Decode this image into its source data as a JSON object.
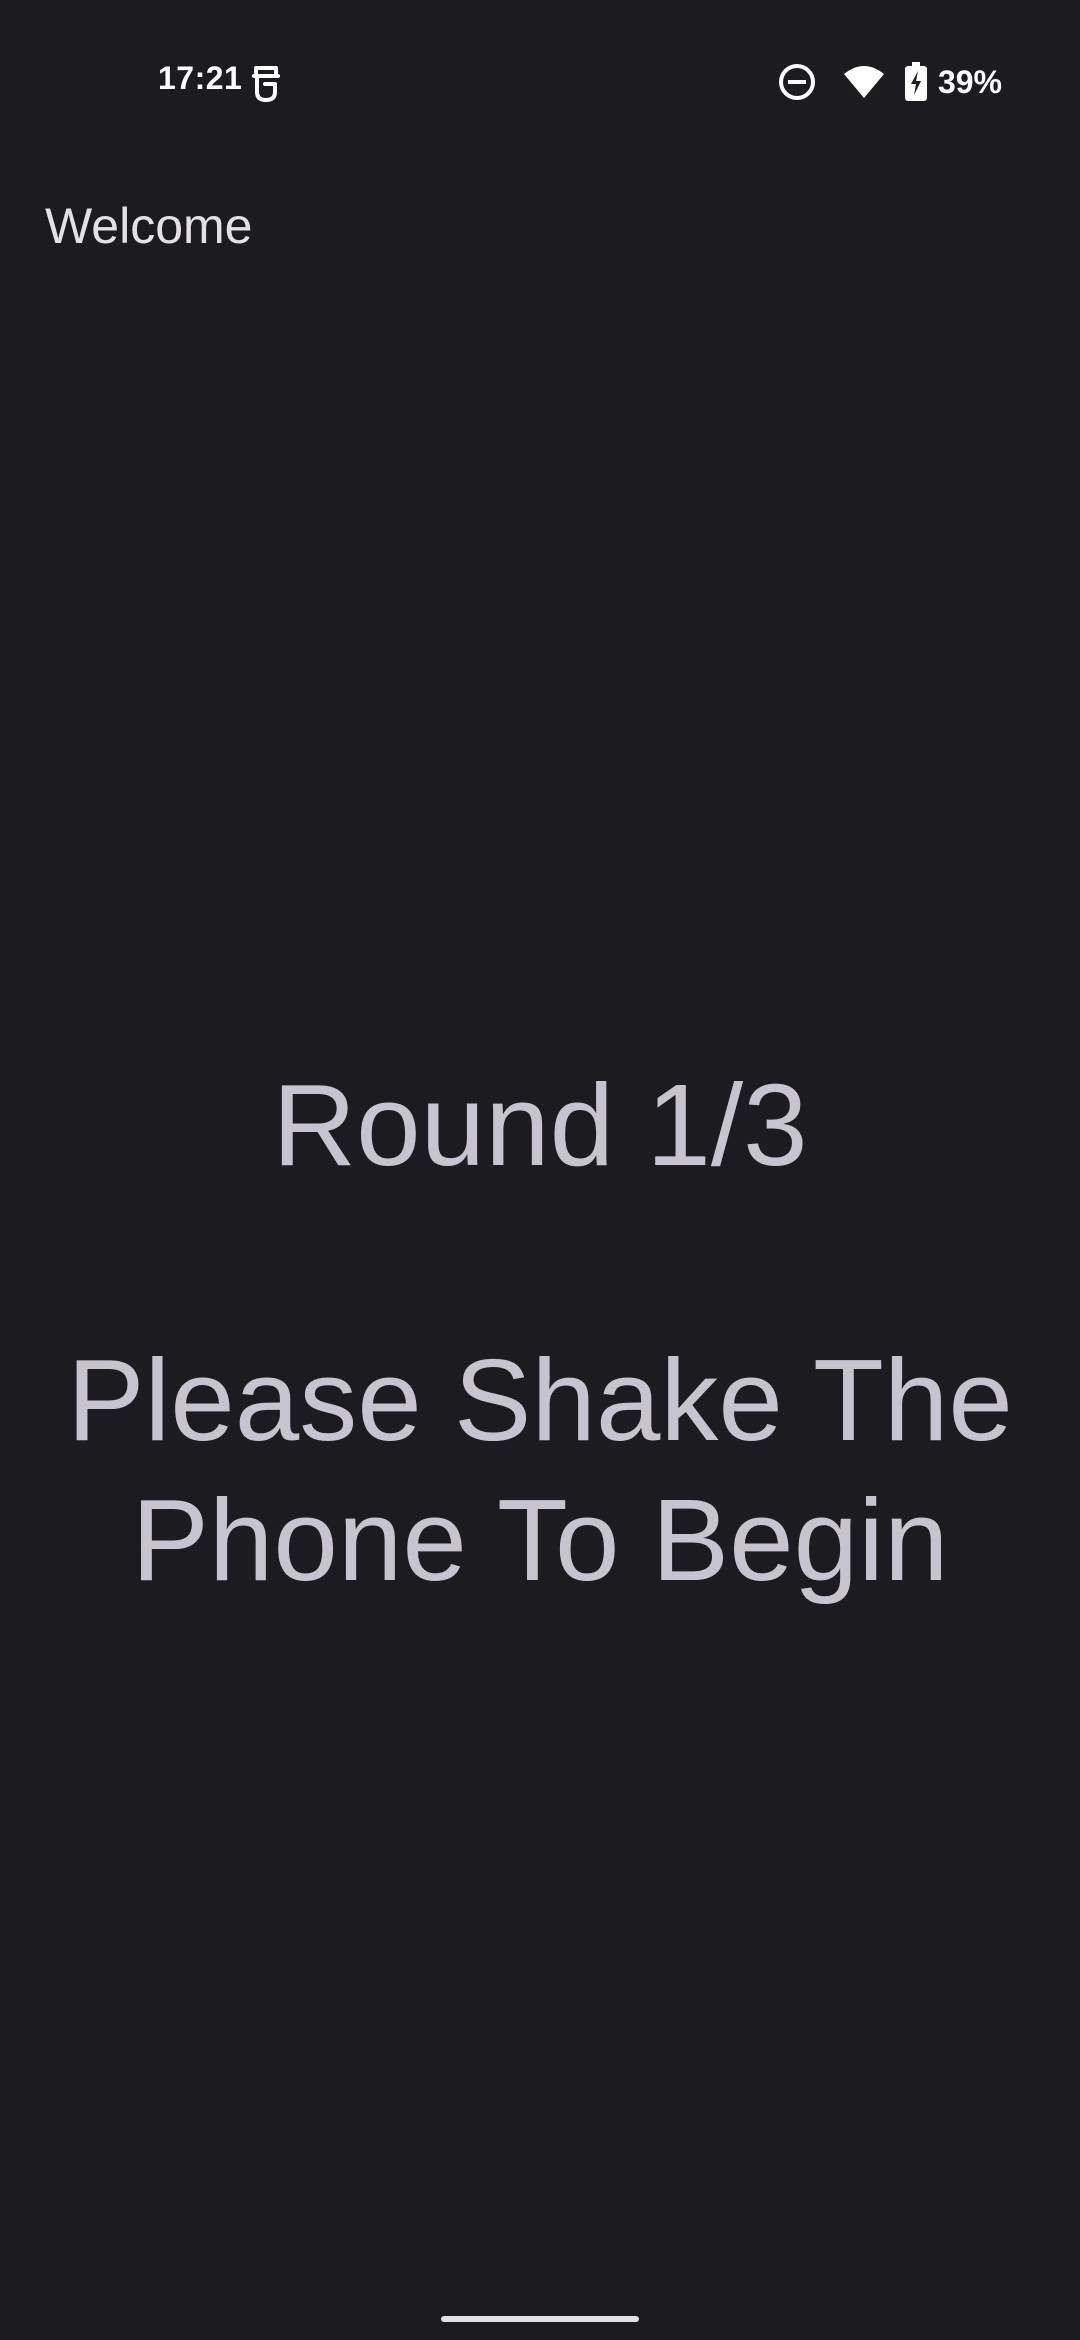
{
  "status_bar": {
    "time": "17:21",
    "battery_percent": "39%",
    "icons": [
      "app-notification-icon",
      "do-not-disturb-icon",
      "wifi-icon",
      "battery-charging-icon"
    ]
  },
  "app_bar": {
    "title": "Welcome"
  },
  "main": {
    "round_label": "Round 1/3",
    "instruction": "Please Shake The Phone To Begin"
  },
  "colors": {
    "background": "#1c1b20",
    "primary_text": "#c7c4cf",
    "title_text": "#e4e1e6"
  }
}
